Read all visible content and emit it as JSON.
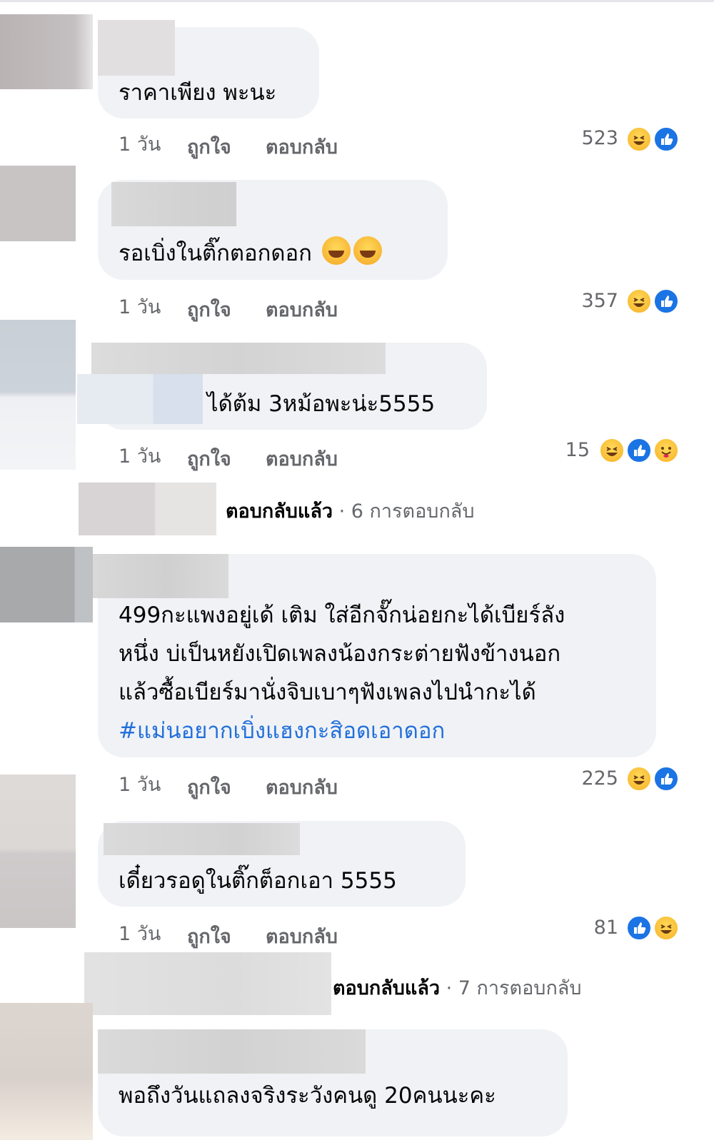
{
  "comments": [
    {
      "text": "ราคาเพียง พะนะ",
      "time": "1 วัน",
      "like": "ถูกใจ",
      "reply": "ตอบกลับ",
      "count": "523",
      "reactions": [
        "haha-icon",
        "like-icon"
      ]
    },
    {
      "text": "รอเบิ่งในติ๊กตอกดอก",
      "time": "1 วัน",
      "like": "ถูกใจ",
      "reply": "ตอบกลับ",
      "count": "357",
      "reactions": [
        "haha-icon",
        "like-icon"
      ],
      "emojis": [
        "rofl-emoji",
        "rofl-emoji"
      ]
    },
    {
      "text": "ได้ต้ม 3หม้อพะน่ะ5555",
      "time": "1 วัน",
      "like": "ถูกใจ",
      "reply": "ตอบกลับ",
      "count": "15",
      "reactions": [
        "haha-icon",
        "like-icon",
        "care-icon"
      ],
      "replies": {
        "replied": "ตอบกลับแล้ว",
        "sep": " · ",
        "count_text": "6 การตอบกลับ"
      }
    },
    {
      "lines": [
        "499กะแพงอยู่เด้ เติม ใส่อีกจั๊กน่อยกะได้เบียร์ลัง",
        "หนึ่ง บ่เป็นหยังเปิดเพลงน้องกระต่ายฟังข้างนอก",
        "แล้วซื้อเบียร์มานั่งจิบเบาๆฟังเพลงไปนำกะได้"
      ],
      "hashtag": "#แม่นอยากเบิ่งแฮงกะสิอดเอาดอก",
      "time": "1 วัน",
      "like": "ถูกใจ",
      "reply": "ตอบกลับ",
      "count": "225",
      "reactions": [
        "haha-icon",
        "like-icon"
      ]
    },
    {
      "text": "เดี๋ยวรอดูในติ๊กต็อกเอา 5555",
      "time": "1 วัน",
      "like": "ถูกใจ",
      "reply": "ตอบกลับ",
      "count": "81",
      "reactions": [
        "like-icon",
        "haha-icon"
      ],
      "replies": {
        "replied": "ตอบกลับแล้ว",
        "sep": " · ",
        "count_text": "7 การตอบกลับ"
      }
    },
    {
      "text": "พอถึงวันแถลงจริงระวังคนดู 20คนนะคะ"
    }
  ],
  "colors": {
    "bubble": "#f0f2f5",
    "meta": "#65676b",
    "hashtag": "#216fdb",
    "like": "#1b74e4",
    "haha": "#f7b125"
  }
}
